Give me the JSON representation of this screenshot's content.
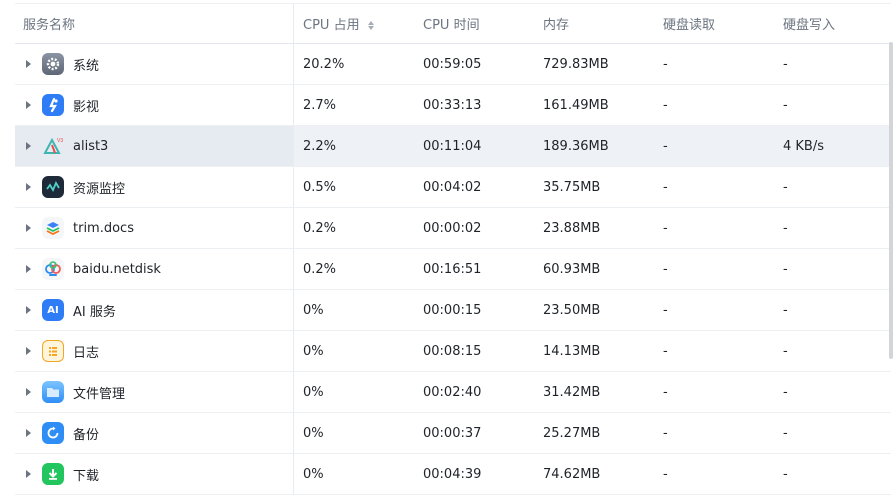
{
  "header": {
    "name": "服务名称",
    "cpu": "CPU 占用",
    "cpu_time": "CPU 时间",
    "memory": "内存",
    "disk_read": "硬盘读取",
    "disk_write": "硬盘写入"
  },
  "rows": [
    {
      "icon": "settings-gear-icon",
      "name": "系统",
      "cpu": "20.2%",
      "time": "00:59:05",
      "mem": "729.83MB",
      "read": "-",
      "write": "-"
    },
    {
      "icon": "video-app-icon",
      "name": "影视",
      "cpu": "2.7%",
      "time": "00:33:13",
      "mem": "161.49MB",
      "read": "-",
      "write": "-"
    },
    {
      "icon": "alist-icon",
      "name": "alist3",
      "cpu": "2.2%",
      "time": "00:11:04",
      "mem": "189.36MB",
      "read": "-",
      "write": "4 KB/s"
    },
    {
      "icon": "resource-monitor-icon",
      "name": "资源监控",
      "cpu": "0.5%",
      "time": "00:04:02",
      "mem": "35.75MB",
      "read": "-",
      "write": "-"
    },
    {
      "icon": "trim-docs-icon",
      "name": "trim.docs",
      "cpu": "0.2%",
      "time": "00:00:02",
      "mem": "23.88MB",
      "read": "-",
      "write": "-"
    },
    {
      "icon": "baidu-netdisk-icon",
      "name": "baidu.netdisk",
      "cpu": "0.2%",
      "time": "00:16:51",
      "mem": "60.93MB",
      "read": "-",
      "write": "-"
    },
    {
      "icon": "ai-service-icon",
      "name": "AI 服务",
      "cpu": "0%",
      "time": "00:00:15",
      "mem": "23.50MB",
      "read": "-",
      "write": "-"
    },
    {
      "icon": "log-icon",
      "name": "日志",
      "cpu": "0%",
      "time": "00:08:15",
      "mem": "14.13MB",
      "read": "-",
      "write": "-"
    },
    {
      "icon": "file-manager-icon",
      "name": "文件管理",
      "cpu": "0%",
      "time": "00:02:40",
      "mem": "31.42MB",
      "read": "-",
      "write": "-"
    },
    {
      "icon": "backup-icon",
      "name": "备份",
      "cpu": "0%",
      "time": "00:00:37",
      "mem": "25.27MB",
      "read": "-",
      "write": "-"
    },
    {
      "icon": "download-icon",
      "name": "下载",
      "cpu": "0%",
      "time": "00:04:39",
      "mem": "74.62MB",
      "read": "-",
      "write": "-"
    }
  ],
  "ai_icon_text": "AI",
  "colors": {
    "selected_row": "#eef1f6",
    "header_text": "#6b7480",
    "border": "#edf0f3"
  }
}
